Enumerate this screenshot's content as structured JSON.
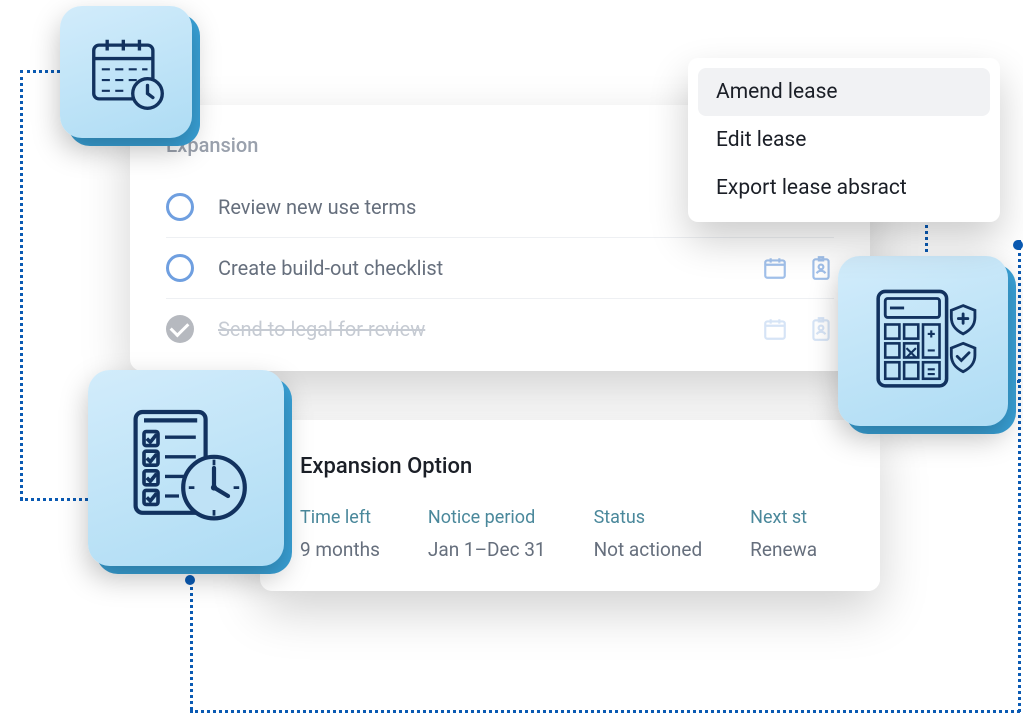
{
  "tasks": {
    "heading": "Expansion",
    "items": [
      {
        "label": "Review new use terms",
        "done": false
      },
      {
        "label": "Create build-out checklist",
        "done": false
      },
      {
        "label": "Send to legal for review",
        "done": true
      }
    ]
  },
  "menu": {
    "items": [
      {
        "label": "Amend lease",
        "highlight": true
      },
      {
        "label": "Edit lease",
        "highlight": false
      },
      {
        "label": "Export lease absract",
        "highlight": false
      }
    ]
  },
  "option": {
    "heading": "Expansion Option",
    "columns": [
      {
        "lbl": "Time left",
        "val": "9 months"
      },
      {
        "lbl": "Notice period",
        "val": "Jan 1–Dec 31"
      },
      {
        "lbl": "Status",
        "val": "Not actioned"
      },
      {
        "lbl": "Next st",
        "val": "Renewa"
      }
    ]
  },
  "colors": {
    "accent": "#0a5ab3",
    "tile_bg": "#aedcf4",
    "tile_shadow": "#3aa3d9"
  },
  "icons": {
    "calendar": "calendar-icon",
    "checklist_clock": "checklist-clock-icon",
    "calculator": "calculator-icon",
    "shield_plus": "shield-plus-icon",
    "shield_check": "shield-check-icon",
    "mini_calendar": "calendar-icon",
    "mini_badge": "id-badge-icon"
  }
}
